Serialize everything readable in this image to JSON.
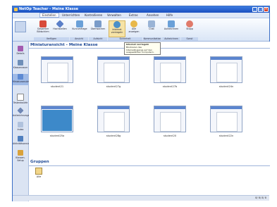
{
  "window": {
    "title": "NetOp Teacher - Meine Klasse",
    "controls": [
      "_",
      "□",
      "×"
    ]
  },
  "menu": [
    {
      "label": "Einstellen",
      "active": true
    },
    {
      "label": "Unterrichten",
      "active": false
    },
    {
      "label": "Kontrollieren",
      "active": false
    },
    {
      "label": "Verwalten",
      "active": false
    },
    {
      "label": "Extras",
      "active": false
    },
    {
      "label": "Ansehen",
      "active": false
    },
    {
      "label": "Hilfe",
      "active": false
    }
  ],
  "ribbon": {
    "buttons": [
      {
        "label": "Gesamter Bildschirm",
        "icon": "monitor-icon",
        "color": "#d84a3a"
      },
      {
        "label": "Hochstellen",
        "icon": "raise-icon",
        "color": "#5a7fc8"
      },
      {
        "label": "Kurzumfrage",
        "icon": "poll-icon",
        "color": "#6aa0d8"
      },
      {
        "label": "Überwachen",
        "icon": "monitor-watch-icon",
        "color": "#7a9cc9"
      },
      {
        "label": "Internet verriegeln",
        "icon": "globe-lock-icon",
        "color": "#4a90c8"
      },
      {
        "label": "Alle anzeigen",
        "icon": "smiley-icon",
        "color": "#e8b84a"
      },
      {
        "label": "Chat",
        "icon": "chat-icon",
        "color": "#9ab4d6"
      },
      {
        "label": "Aufzeichnen",
        "icon": "record-icon",
        "color": "#6aa0d8"
      },
      {
        "label": "Stopp",
        "icon": "stop-icon",
        "color": "#e07a6a"
      }
    ],
    "groups": [
      "Verfügen",
      "Ansicht",
      "Aufsicht",
      "Sicherheit",
      "Kommunikation",
      "Aufzeichnen",
      "Sonst"
    ]
  },
  "tooltip": {
    "title": "Internet verriegeln",
    "body": "Blockieren des Internetzugangs auf den ausgewählten Computern."
  },
  "left_nav": [
    {
      "label": "Details",
      "icon": "details-icon",
      "selected": false
    },
    {
      "label": "Klassenraum",
      "icon": "classroom-icon",
      "selected": false
    },
    {
      "label": "Miniaturansicht",
      "icon": "thumbnails-icon",
      "selected": true
    },
    {
      "label": "Testentwürfe",
      "icon": "test-icon",
      "selected": false
    },
    {
      "label": "Aufzeichnungen",
      "icon": "recordings-icon",
      "selected": false
    },
    {
      "label": "Index",
      "icon": "index-icon",
      "selected": false
    },
    {
      "label": "Aktivitätsansicht",
      "icon": "activity-icon",
      "selected": false
    },
    {
      "label": "Klassen-Setup",
      "icon": "setup-icon",
      "selected": false
    }
  ],
  "main": {
    "heading": "Miniaturansicht - Meine Klasse",
    "thumbnails": [
      {
        "name": "student21",
        "kind": "doc"
      },
      {
        "name": "student27g",
        "kind": "doc"
      },
      {
        "name": "student27b",
        "kind": "doc"
      },
      {
        "name": "student24n",
        "kind": "doc"
      },
      {
        "name": "student25a",
        "kind": "desk"
      },
      {
        "name": "student28g",
        "kind": "doc"
      },
      {
        "name": "student20",
        "kind": "doc"
      },
      {
        "name": "student22n",
        "kind": "doc"
      }
    ]
  },
  "groups": {
    "heading": "Gruppen",
    "items": [
      {
        "label": "Alle"
      }
    ]
  },
  "status": {
    "text": "8/  8/  8/  8"
  }
}
